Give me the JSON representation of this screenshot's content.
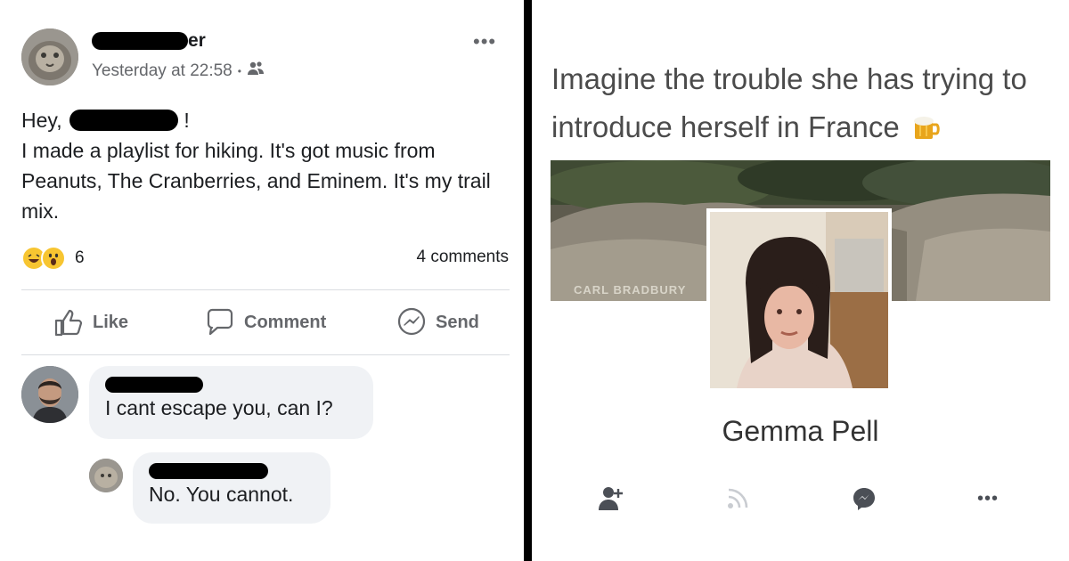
{
  "left": {
    "author": {
      "name_visible_suffix": "er"
    },
    "timestamp": "Yesterday at 22:58",
    "separator": "•",
    "more_menu": "•••",
    "post_greeting_prefix": "Hey,",
    "post_greeting_suffix": "!",
    "post_body": "I made a playlist for hiking. It's got music from Peanuts, The Cranberries, and Eminem. It's my trail mix.",
    "reaction_count": "6",
    "comments_count": "4 comments",
    "actions": {
      "like": "Like",
      "comment": "Comment",
      "send": "Send"
    },
    "comments": [
      {
        "text": "I cant escape you, can I?"
      },
      {
        "text": "No. You cannot."
      }
    ]
  },
  "right": {
    "caption": "Imagine the trouble she has trying to introduce herself in France",
    "cover_watermark": "CARL BRADBURY",
    "profile_name": "Gemma Pell",
    "more_menu": "•••"
  },
  "icons": {
    "audience": "friends-icon",
    "like": "thumbs-up-icon",
    "comment": "speech-bubble-icon",
    "send": "messenger-icon",
    "reactions": [
      "laughing-emoji-icon",
      "wow-emoji-icon"
    ],
    "right_actions": [
      "add-friend-icon",
      "follow-rss-icon",
      "messenger-icon",
      "more-icon"
    ]
  },
  "colors": {
    "divider": "#000000",
    "bubble": "#f0f2f5",
    "muted_text": "#65676b",
    "reaction_yellow": "#f7c531"
  }
}
